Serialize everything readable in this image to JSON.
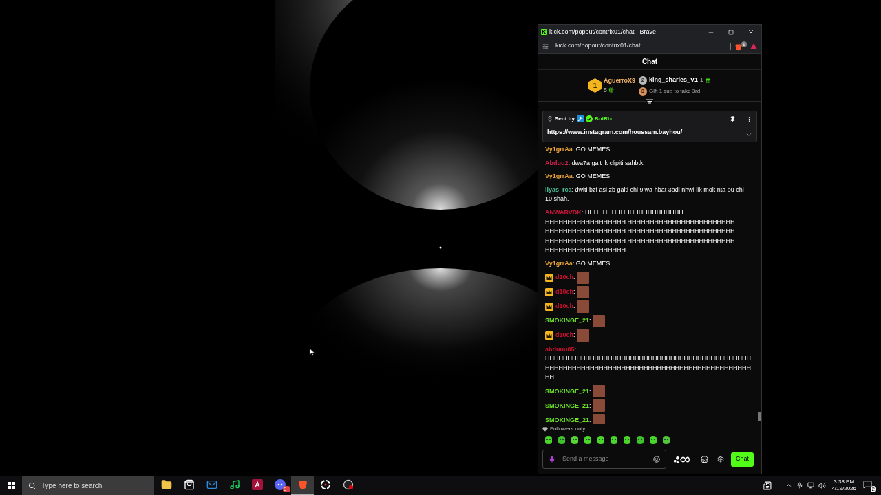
{
  "window": {
    "title": "kick.com/popout/contrix01/chat - Brave",
    "url": "kick.com/popout/contrix01/chat",
    "shield_count": "1"
  },
  "chat": {
    "title": "Chat",
    "leaderboard": [
      {
        "rank": "1",
        "name": "AguerroX9",
        "count": "5"
      },
      {
        "rank": "2",
        "name": "king_sharies_V1",
        "count": "1"
      }
    ],
    "leaderboard_next": {
      "rank": "3",
      "text": "Gift 1 sub to take 3rd"
    },
    "pinned": {
      "label": "Sent by",
      "author": "BotRix",
      "link": "https://www.instagram.com/houssam.bayhou/"
    },
    "messages": [
      {
        "user": "Vy1grrAa",
        "color": "#e8a23a",
        "kind": "text",
        "badge": false,
        "separator": ":",
        "text": "GO MEMES"
      },
      {
        "user": "Abduu2",
        "color": "#d2204d",
        "kind": "text",
        "badge": false,
        "separator": ":",
        "text": "dwa7a galt lk clipiti sahbtk"
      },
      {
        "user": "Vy1grrAa",
        "color": "#e8a23a",
        "kind": "text",
        "badge": false,
        "separator": ":",
        "text": "GO MEMES"
      },
      {
        "user": "ilyas_rca",
        "color": "#4fc9a0",
        "kind": "text",
        "badge": false,
        "separator": ":",
        "text": "dwiti bzf asi zb galti chi 9lwa hbat 3adi nhwi lik mok nta ou chi 10 shah."
      },
      {
        "user": "ANWARVDK",
        "color": "#d5143c",
        "kind": "text",
        "badge": false,
        "separator": ":",
        "text": "HHHHHHHHHHHHHHHHHHHHHH HHHHHHHHHHHHHHHHHH HHHHHHHHHHHHHHHHHHHHHHHH HHHHHHHHHHHHHHHHHH HHHHHHHHHHHHHHHHHHHHHHHH HHHHHHHHHHHHHHHHHH HHHHHHHHHHHHHHHHHHHHHHHH HHHHHHHHHHHHHHHHHH"
      },
      {
        "user": "Vy1grrAa",
        "color": "#e8a23a",
        "kind": "text",
        "badge": false,
        "separator": ":",
        "text": "GO MEMES"
      },
      {
        "user": "d10ch",
        "color": "#c8102e",
        "kind": "emote",
        "badge": true,
        "separator": ":"
      },
      {
        "user": "d10ch",
        "color": "#c8102e",
        "kind": "emote",
        "badge": true,
        "separator": ":"
      },
      {
        "user": "d10ch",
        "color": "#c8102e",
        "kind": "emote",
        "badge": true,
        "separator": ":"
      },
      {
        "user": "SMOKINGE_21",
        "color": "#6ee62a",
        "kind": "emote",
        "badge": false,
        "separator": ":"
      },
      {
        "user": "d10ch",
        "color": "#c8102e",
        "kind": "emote",
        "badge": true,
        "separator": ":"
      },
      {
        "user": "abduuu05",
        "color": "#c8102e",
        "kind": "text",
        "badge": false,
        "separator": ":",
        "text": "HHHHHHHHHHHHHHHHHHHHHHHHHHHHHHHHHHHHHHHHHHHHHHHHHHHHHHHHHHHHHHHHHHHHHHHHHHHHHHHHHHHHHHHHHHHHHH"
      },
      {
        "user": "SMOKINGE_21",
        "color": "#6ee62a",
        "kind": "emote",
        "badge": false,
        "separator": ":"
      },
      {
        "user": "SMOKINGE_21",
        "color": "#6ee62a",
        "kind": "emote",
        "badge": false,
        "separator": ":"
      },
      {
        "user": "SMOKINGE_21",
        "color": "#6ee62a",
        "kind": "emote",
        "badge": false,
        "separator": ":"
      }
    ],
    "mode": "Followers only",
    "input": {
      "placeholder": "Send a message"
    },
    "send_button": "Chat"
  },
  "taskbar": {
    "search_placeholder": "Type here to search",
    "apps": [
      {
        "kind": "folder",
        "selected": false
      },
      {
        "kind": "store",
        "selected": false
      },
      {
        "kind": "mail",
        "selected": false
      },
      {
        "kind": "music",
        "selected": false
      },
      {
        "kind": "letter",
        "selected": false
      },
      {
        "kind": "chat",
        "selected": false,
        "badge": "9+"
      },
      {
        "kind": "lion",
        "selected": true
      },
      {
        "kind": "ring",
        "selected": false
      },
      {
        "kind": "record",
        "selected": false
      }
    ],
    "time": "3:38 PM",
    "date": "4/19/2026",
    "notifications": "2"
  }
}
